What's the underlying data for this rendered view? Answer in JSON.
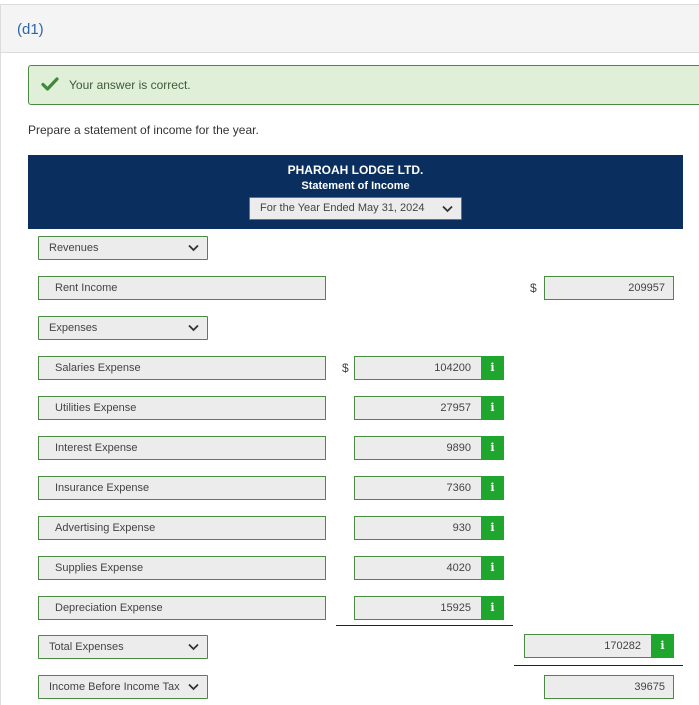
{
  "part": {
    "label": "(d1)"
  },
  "feedback": {
    "icon": "check-icon",
    "message": "Your answer is correct.",
    "color": "#dfefd8"
  },
  "prompt": "Prepare a statement of income for the year.",
  "statement": {
    "company": "PHAROAH LODGE LTD.",
    "title": "Statement of Income",
    "period": "For the Year Ended May 31, 2024",
    "header_color": "#0a2f5f",
    "currency_symbol": "$",
    "revenues_heading": "Revenues",
    "revenue_items": [
      {
        "label": "Rent Income",
        "amount": "209957"
      }
    ],
    "expenses_heading": "Expenses",
    "expense_items": [
      {
        "label": "Salaries Expense",
        "amount": "104200"
      },
      {
        "label": "Utilities Expense",
        "amount": "27957"
      },
      {
        "label": "Interest Expense",
        "amount": "9890"
      },
      {
        "label": "Insurance Expense",
        "amount": "7360"
      },
      {
        "label": "Advertising Expense",
        "amount": "930"
      },
      {
        "label": "Supplies Expense",
        "amount": "4020"
      },
      {
        "label": "Depreciation Expense",
        "amount": "15925"
      }
    ],
    "total_expenses": {
      "label": "Total Expenses",
      "amount": "170282"
    },
    "income_before_tax": {
      "label": "Income Before Income Tax",
      "amount": "39675"
    },
    "info_glyph": "i",
    "accent_color": "#1fa62e"
  }
}
